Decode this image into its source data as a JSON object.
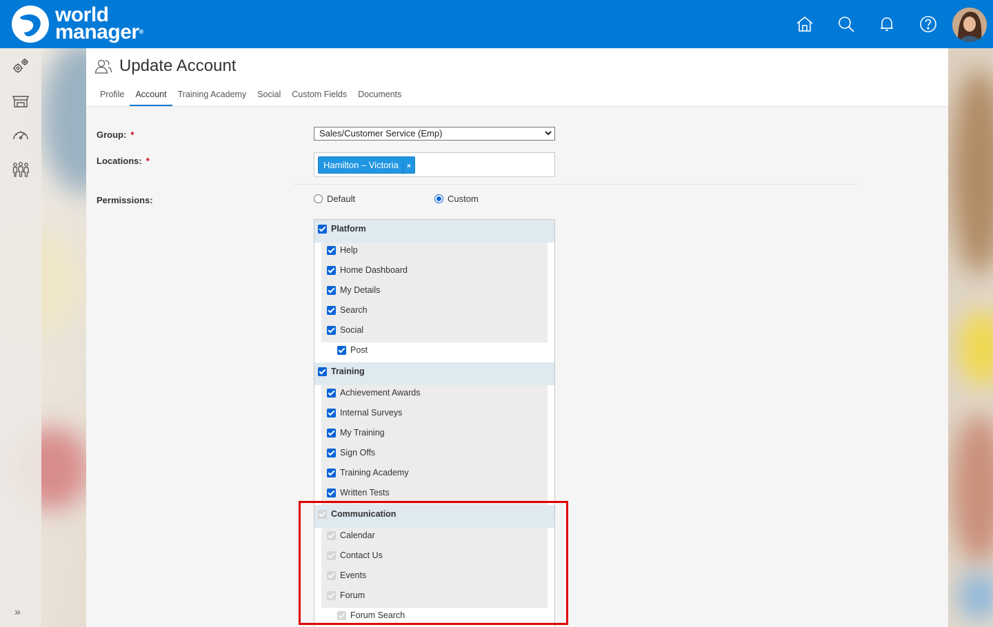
{
  "app": {
    "brand_line1": "world",
    "brand_line2": "manager",
    "brand_reg": "®"
  },
  "top_nav": {
    "icons": [
      "home-icon",
      "search-icon",
      "bell-icon",
      "help-icon",
      "user-avatar"
    ]
  },
  "sidebar": {
    "icons": [
      "settings-gears-icon",
      "store-icon",
      "dashboard-gauge-icon",
      "people-group-icon"
    ],
    "expand_label": "»"
  },
  "page": {
    "title": "Update Account",
    "tabs": [
      {
        "label": "Profile",
        "active": false
      },
      {
        "label": "Account",
        "active": true
      },
      {
        "label": "Training Academy",
        "active": false
      },
      {
        "label": "Social",
        "active": false
      },
      {
        "label": "Custom Fields",
        "active": false
      },
      {
        "label": "Documents",
        "active": false
      }
    ]
  },
  "form": {
    "group_label": "Group:",
    "group_value": "Sales/Customer Service (Emp)",
    "locations_label": "Locations:",
    "location_tag": "Hamilton – Victoria",
    "location_remove": "×",
    "required_mark": "*",
    "permissions_label": "Permissions:",
    "permission_modes": [
      {
        "label": "Default",
        "selected": false
      },
      {
        "label": "Custom",
        "selected": true
      }
    ]
  },
  "permissions": {
    "platform": {
      "label": "Platform",
      "items": [
        "Help",
        "Home Dashboard",
        "My Details",
        "Search",
        "Social"
      ],
      "sub_item": "Post"
    },
    "training": {
      "label": "Training",
      "items": [
        "Achievement Awards",
        "Internal Surveys",
        "My Training",
        "Sign Offs",
        "Training Academy",
        "Written Tests"
      ]
    },
    "communication": {
      "label": "Communication",
      "disabled": true,
      "items": [
        "Calendar",
        "Contact Us",
        "Events",
        "Forum"
      ],
      "sub_item": "Forum Search"
    }
  },
  "colors": {
    "header_blue": "#0079d7",
    "checkbox_blue": "#0a64d8",
    "highlight_red": "#e00000",
    "tag_blue": "#2196e3"
  }
}
